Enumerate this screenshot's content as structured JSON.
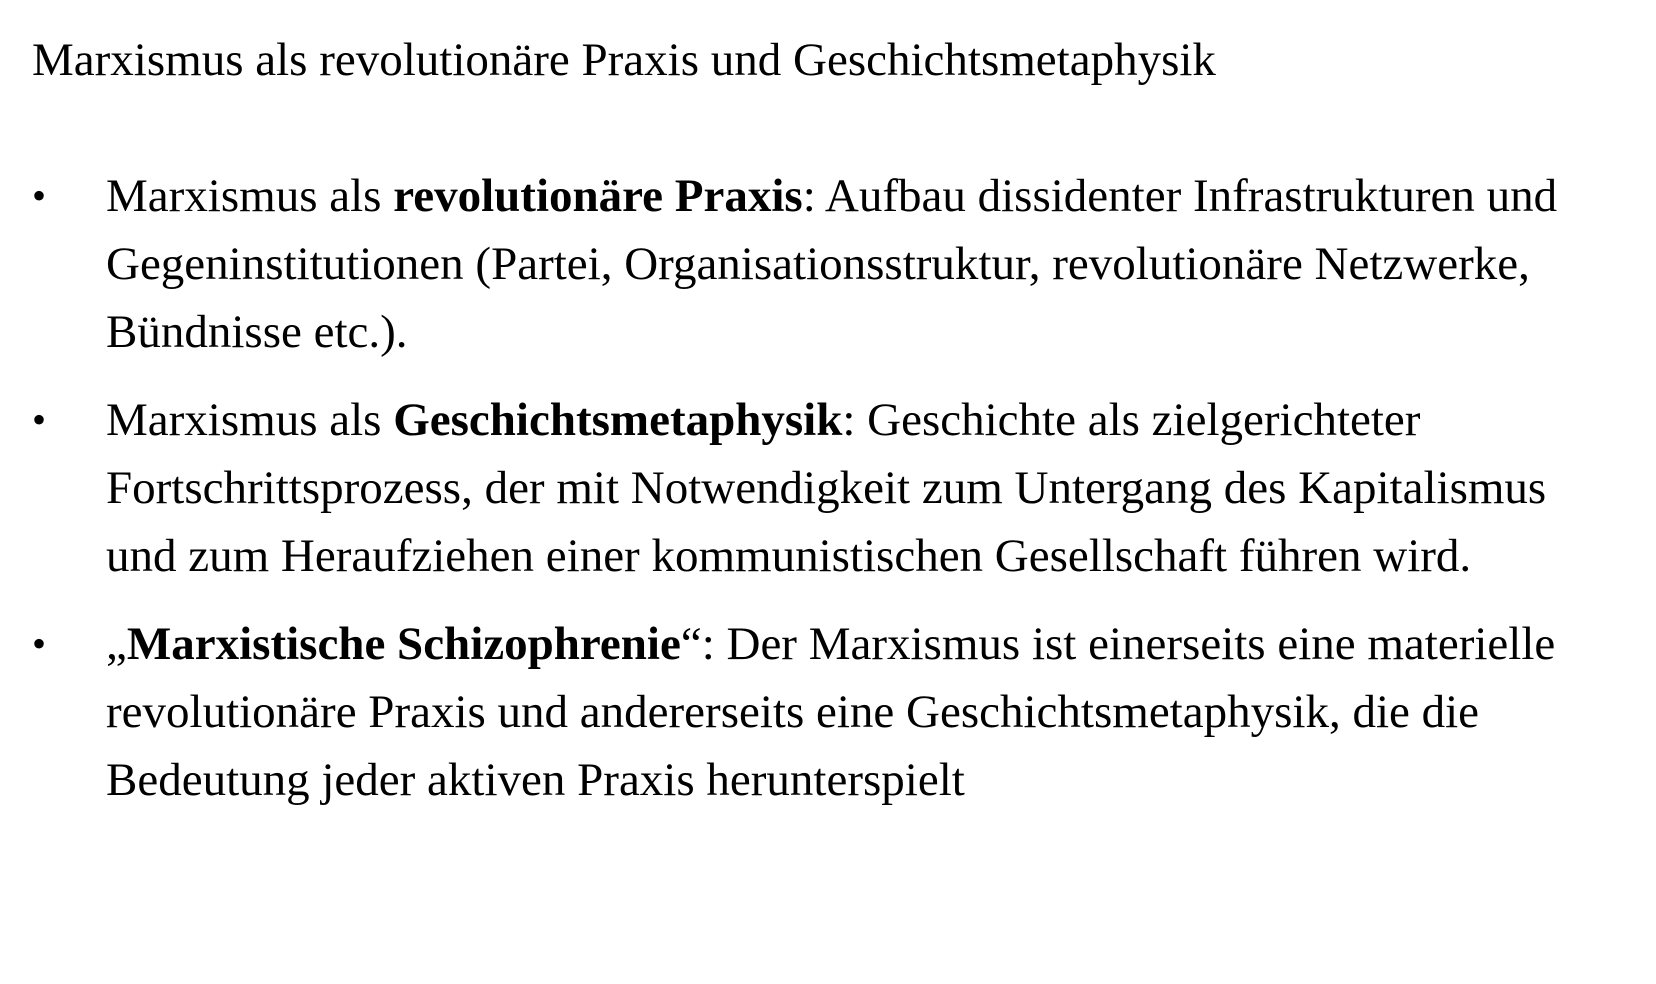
{
  "title": "Marxismus als revolutionäre Praxis und Geschichtsmetaphysik",
  "bullet_marker": "•",
  "bullets": [
    {
      "prefix": "Marxismus als ",
      "bold": "revolutionäre Praxis",
      "suffix": ": Aufbau dissidenter Infrastrukturen und Gegeninstitutionen (Partei, Organisationsstruktur, revolutionäre Netzwerke, Bündnisse etc.)."
    },
    {
      "prefix": "Marxismus als ",
      "bold": "Geschichtsmetaphysik",
      "suffix": ": Geschichte als zielgerichteter Fortschrittsprozess, der mit Notwendigkeit zum Untergang des Kapitalismus und zum Heraufziehen einer kommunistischen Gesellschaft führen wird."
    },
    {
      "prefix": "„",
      "bold": "Marxistische Schizophrenie",
      "suffix": "“: Der Marxismus ist einerseits eine materielle revolutionäre Praxis und andererseits eine Geschichtsmetaphysik, die die Bedeutung jeder aktiven Praxis herunterspielt"
    }
  ]
}
